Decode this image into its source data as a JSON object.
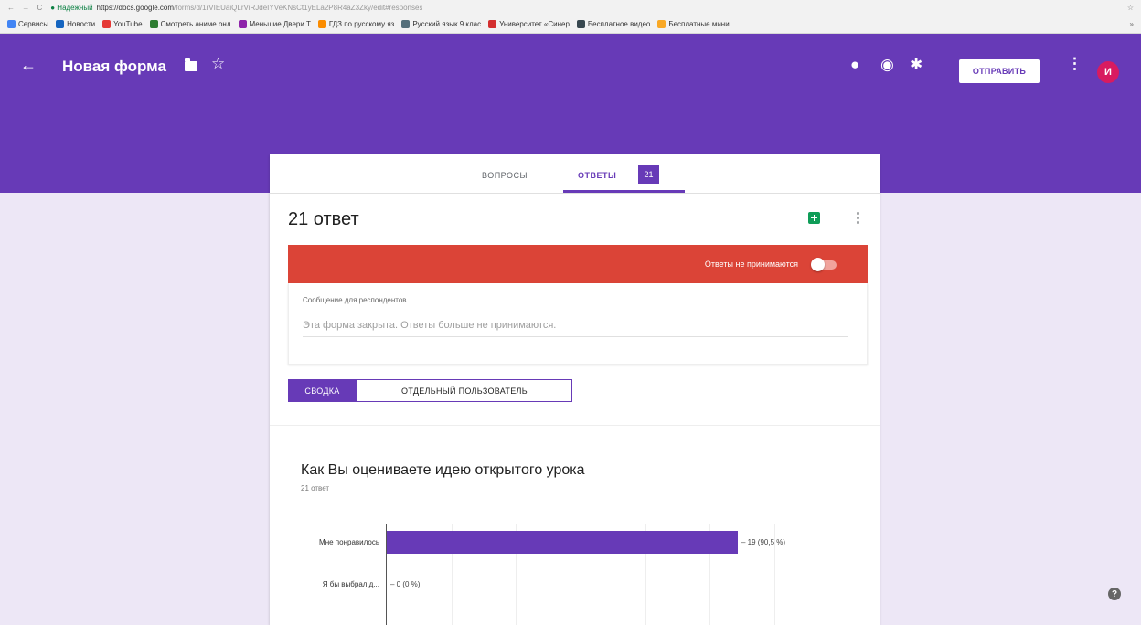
{
  "browser": {
    "nav": "← → C",
    "secure_label": "● Надежный",
    "url_host": "https://docs.google.com",
    "url_path": "/forms/d/1rVIEUaiQLrViRJdeIYVeKNsCt1yELa2P8R4aZ3Zky/edit#responses",
    "star": "☆"
  },
  "bookmarks": [
    {
      "label": "Сервисы",
      "color": "#4285f4"
    },
    {
      "label": "Новости",
      "color": "#1565c0"
    },
    {
      "label": "YouTube",
      "color": "#e53935"
    },
    {
      "label": "Смотреть аниме онл",
      "color": "#2e7d32"
    },
    {
      "label": "Меньшие Двери Т",
      "color": "#8e24aa"
    },
    {
      "label": "ГДЗ по русскому яз",
      "color": "#fb8c00"
    },
    {
      "label": "Русский язык 9 клас",
      "color": "#546e7a"
    },
    {
      "label": "Университет «Синер",
      "color": "#d32f2f"
    },
    {
      "label": "Бесплатное видео",
      "color": "#37474f"
    },
    {
      "label": "Бесплатные мини",
      "color": "#f9a825"
    }
  ],
  "bookmarks_more": "»",
  "header": {
    "back": "←",
    "title": "Новая форма",
    "star": "☆",
    "palette": "●",
    "preview": "◉",
    "settings": "✱",
    "send_label": "ОТПРАВИТЬ",
    "more": "⋮",
    "avatar_letter": "И",
    "brand_color": "#673ab7"
  },
  "tabs": {
    "questions": "ВОПРОСЫ",
    "answers": "ОТВЕТЫ",
    "count": "21"
  },
  "responses": {
    "title": "21 ответ",
    "more": "⋮",
    "accepting_label": "Ответы не принимаются",
    "message_label": "Сообщение для респондентов",
    "message_text": "Эта форма закрыта. Ответы больше не принимаются."
  },
  "view_toggle": {
    "summary": "СВОДКА",
    "individual": "ОТДЕЛЬНЫЙ ПОЛЬЗОВАТЕЛЬ"
  },
  "question": {
    "title": "Как Вы оцениваете идею открытого урока",
    "subtitle": "21 ответ"
  },
  "chart_data": {
    "type": "bar",
    "orientation": "horizontal",
    "categories": [
      "Мне понравилось",
      "Я бы выбрал д..."
    ],
    "values": [
      19,
      0
    ],
    "value_labels": [
      "19 (90,5 %)",
      "0 (0 %)"
    ],
    "xlim": [
      0,
      21
    ],
    "color": "#673ab7"
  },
  "help": "?"
}
